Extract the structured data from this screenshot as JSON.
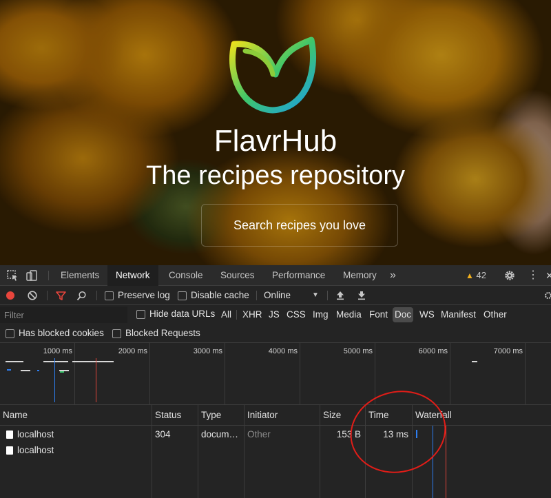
{
  "hero": {
    "brand": "FlavrHub",
    "tagline": "The recipes repository",
    "search_placeholder": "Search recipes you love"
  },
  "devtools": {
    "tabs": [
      "Elements",
      "Network",
      "Console",
      "Sources",
      "Performance",
      "Memory"
    ],
    "active_tab": "Network",
    "more_tabs_icon": "chevron-double-right-icon",
    "warning_count": "42",
    "toolbar": {
      "preserve_log": "Preserve log",
      "disable_cache": "Disable cache",
      "throttling": "Online"
    },
    "filter": {
      "placeholder": "Filter",
      "hide_data_urls": "Hide data URLs",
      "types": [
        "All",
        "XHR",
        "JS",
        "CSS",
        "Img",
        "Media",
        "Font",
        "Doc",
        "WS",
        "Manifest",
        "Other"
      ],
      "active_type": "Doc",
      "has_blocked_cookies": "Has blocked cookies",
      "blocked_requests": "Blocked Requests"
    },
    "overview": {
      "ticks": [
        "1000 ms",
        "2000 ms",
        "3000 ms",
        "4000 ms",
        "5000 ms",
        "6000 ms",
        "7000 ms"
      ]
    },
    "table": {
      "columns": [
        "Name",
        "Status",
        "Type",
        "Initiator",
        "Size",
        "Time",
        "Waterfall"
      ],
      "rows": [
        {
          "name": "localhost",
          "status": "304",
          "type": "docum…",
          "initiator": "Other",
          "size": "153 B",
          "time": "13 ms"
        },
        {
          "name": "localhost",
          "status": "",
          "type": "",
          "initiator": "",
          "size": "",
          "time": ""
        }
      ]
    }
  },
  "colors": {
    "record": "#e8453c",
    "filter_active": "#e8453c",
    "dom_content_loaded_line": "#2e7ef0",
    "load_line": "#e0443a",
    "annotation": "#e21d18"
  }
}
